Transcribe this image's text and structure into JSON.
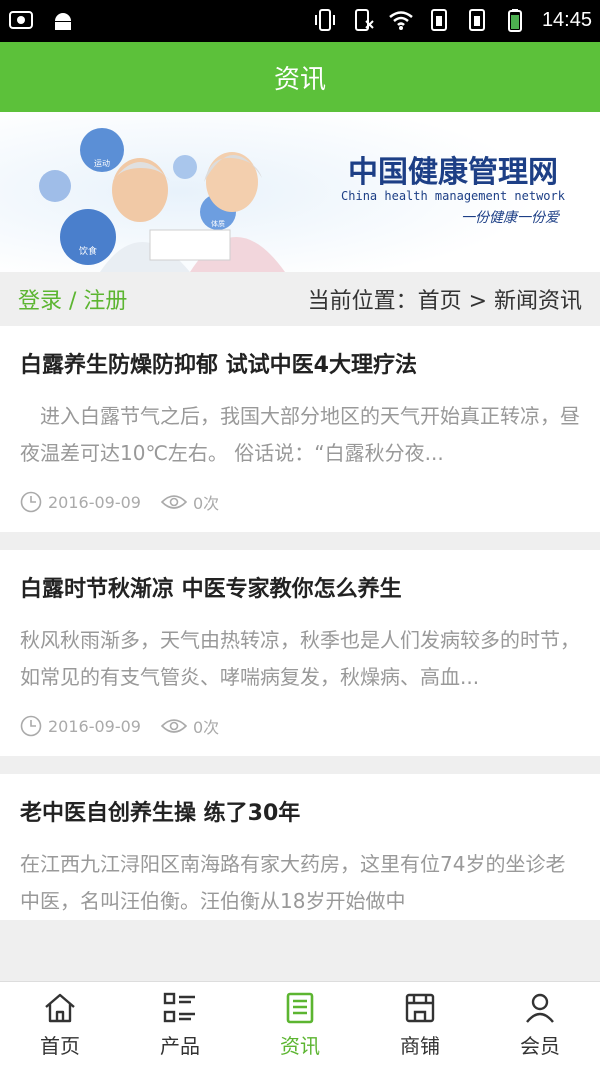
{
  "status": {
    "time": "14:45"
  },
  "header": {
    "title": "资讯"
  },
  "banner": {
    "logo_cn": "中国健康管理网",
    "logo_en": "China health management network",
    "slogan": "一份健康一份爱",
    "bubbles": [
      "运动",
      "饮食",
      "体质"
    ]
  },
  "crumb": {
    "login": "登录 / 注册",
    "location": "当前位置：首页 > 新闻资讯"
  },
  "articles": [
    {
      "title": "白露养生防燥防抑郁 试试中医4大理疗法",
      "summary": "　进入白露节气之后，我国大部分地区的天气开始真正转凉，昼夜温差可达10℃左右。 俗话说：“白露秋分夜...",
      "date": "2016-09-09",
      "views": "0次"
    },
    {
      "title": "白露时节秋渐凉 中医专家教你怎么养生",
      "summary": "秋风秋雨渐多，天气由热转凉，秋季也是人们发病较多的时节，如常见的有支气管炎、哮喘病复发，秋燥病、高血...",
      "date": "2016-09-09",
      "views": "0次"
    },
    {
      "title": "老中医自创养生操 练了30年",
      "summary": "在江西九江浔阳区南海路有家大药房，这里有位74岁的坐诊老中医，名叫汪伯衡。汪伯衡从18岁开始做中"
    }
  ],
  "nav": [
    {
      "label": "首页",
      "icon": "home-icon"
    },
    {
      "label": "产品",
      "icon": "grid-list-icon"
    },
    {
      "label": "资讯",
      "icon": "document-icon",
      "active": true
    },
    {
      "label": "商铺",
      "icon": "store-icon"
    },
    {
      "label": "会员",
      "icon": "user-icon"
    }
  ],
  "colors": {
    "primary": "#5cc13a",
    "active": "#5cb531"
  }
}
